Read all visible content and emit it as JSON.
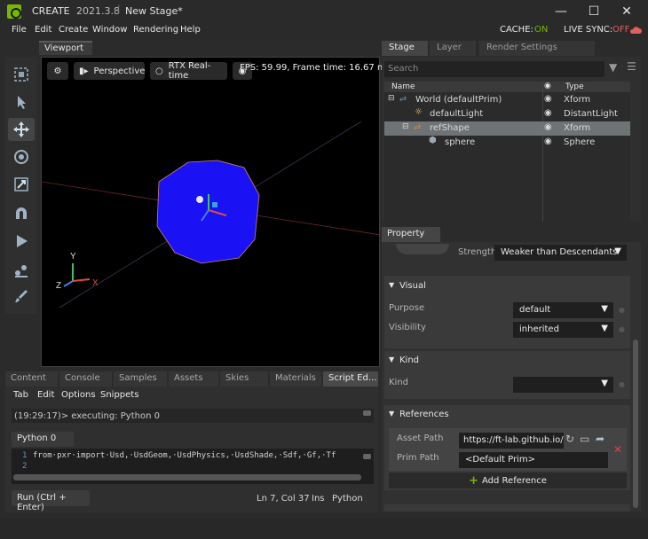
{
  "app": {
    "name": "CREATE",
    "version": "2021.3.8",
    "document": "New Stage*",
    "cache_label": "CACHE:",
    "cache_state": "ON",
    "live_sync_label": "LIVE SYNC:",
    "live_sync_state": "OFF"
  },
  "menu": [
    "File",
    "Edit",
    "Create",
    "Window",
    "Rendering",
    "Help"
  ],
  "viewport": {
    "tab": "Viewport",
    "camera": "Perspective",
    "renderer": "RTX Real-time",
    "fps": "FPS: 59.99, Frame time: 16.67 ms",
    "axes": {
      "y": "Y",
      "z": "Z",
      "x": "X"
    }
  },
  "stage": {
    "tabs": [
      "Stage",
      "Layer",
      "Render Settings"
    ],
    "search_placeholder": "Search",
    "columns": {
      "name": "Name",
      "type": "Type"
    },
    "rows": [
      {
        "name": "World (defaultPrim)",
        "type": "Xform"
      },
      {
        "name": "defaultLight",
        "type": "DistantLight"
      },
      {
        "name": "refShape",
        "type": "Xform"
      },
      {
        "name": "sphere",
        "type": "Sphere"
      }
    ]
  },
  "property": {
    "tab": "Property",
    "strength_label": "Strength",
    "strength_value": "Weaker than Descendants",
    "visual": {
      "title": "Visual",
      "purpose_label": "Purpose",
      "purpose_value": "default",
      "visibility_label": "Visibility",
      "visibility_value": "inherited"
    },
    "kind": {
      "title": "Kind",
      "label": "Kind",
      "value": ""
    },
    "references": {
      "title": "References",
      "asset_label": "Asset Path",
      "asset_value": "https://ft-lab.github.io/u:",
      "prim_label": "Prim Path",
      "prim_value": "<Default Prim>",
      "add_button": "Add Reference"
    }
  },
  "bottom": {
    "tabs": [
      "Content",
      "Console",
      "Samples",
      "Assets",
      "Skies",
      "Materials",
      "Script Ed..."
    ],
    "submenu": [
      "Tab",
      "Edit",
      "Options",
      "Snippets"
    ],
    "log": "(19:29:17)> executing: Python 0",
    "file_tab": "Python 0",
    "code_lines": [
      {
        "num": "1",
        "text": "from·pxr·import·Usd,·UsdGeom,·UsdPhysics,·UsdShade,·Sdf,·Gf,·Tf"
      },
      {
        "num": "2",
        "text": ""
      }
    ],
    "run_button": "Run (Ctrl + Enter)",
    "position": "Ln 7, Col 37",
    "mode": "Ins",
    "language": "Python"
  },
  "colors": {
    "accent_on": "#76b900",
    "accent_off": "#e0605a",
    "sphere": "#1a12f5"
  }
}
